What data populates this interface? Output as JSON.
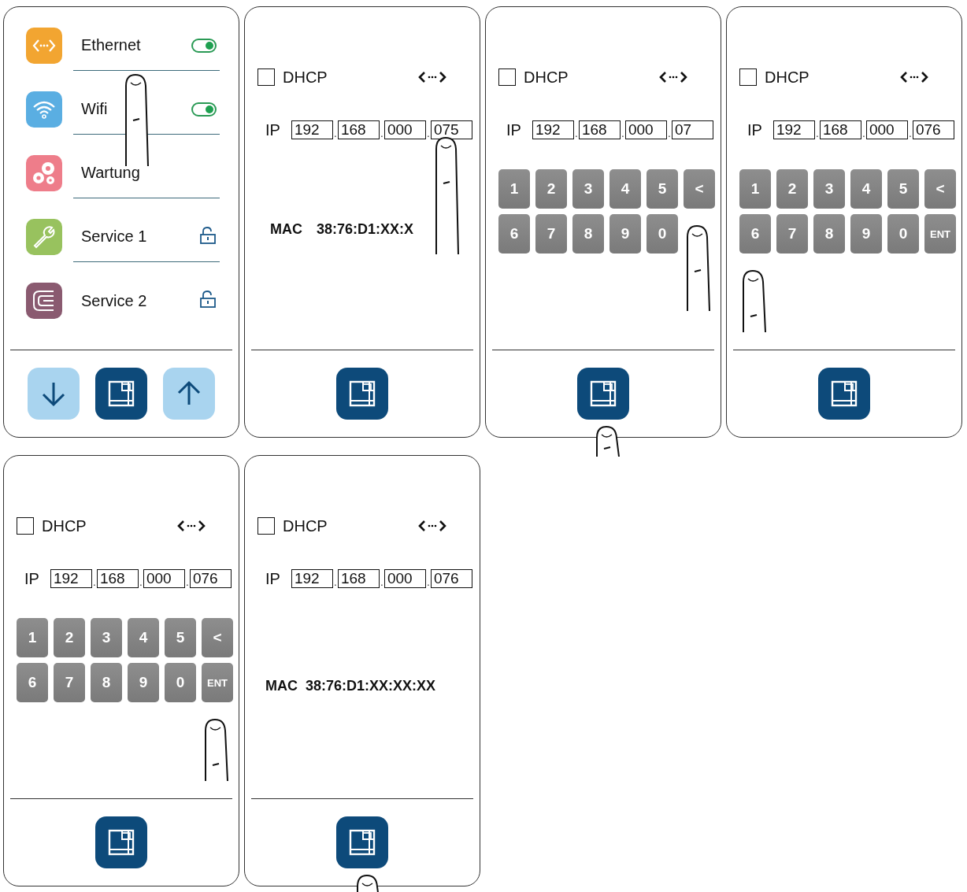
{
  "panels": [
    {
      "kind": "menu",
      "items": [
        {
          "label": "Ethernet",
          "kind": "toggle",
          "on": true,
          "color": "#f2a531"
        },
        {
          "label": "Wifi",
          "kind": "toggle",
          "on": true,
          "color": "#5aaee2"
        },
        {
          "label": "Wartung",
          "kind": "plain",
          "color": "#ee7d8a"
        },
        {
          "label": "Service 1",
          "kind": "lock",
          "color": "#98c25e"
        },
        {
          "label": "Service 2",
          "kind": "lock",
          "color": "#8a5a70"
        }
      ],
      "scroll_buttons": true
    },
    {
      "kind": "network",
      "dhcp": {
        "label": "DHCP",
        "checked": false
      },
      "ip": {
        "label": "IP",
        "separator": ".",
        "octets": [
          "192",
          "168",
          "000",
          "075"
        ]
      },
      "mac": {
        "label": "MAC",
        "value": "38:76:D1:XX:X"
      }
    },
    {
      "kind": "network",
      "dhcp": {
        "label": "DHCP",
        "checked": false
      },
      "ip": {
        "label": "IP",
        "separator": ".",
        "octets": [
          "192",
          "168",
          "000",
          "07"
        ]
      },
      "keys": [
        "1",
        "2",
        "3",
        "4",
        "5",
        "<",
        "6",
        "7",
        "8",
        "9",
        "0"
      ]
    },
    {
      "kind": "network",
      "dhcp": {
        "label": "DHCP",
        "checked": false
      },
      "ip": {
        "label": "IP",
        "separator": ".",
        "octets": [
          "192",
          "168",
          "000",
          "076"
        ]
      },
      "keys": [
        "1",
        "2",
        "3",
        "4",
        "5",
        "<",
        "6",
        "7",
        "8",
        "9",
        "0",
        "ENT"
      ]
    },
    {
      "kind": "network",
      "dhcp": {
        "label": "DHCP",
        "checked": false
      },
      "ip": {
        "label": "IP",
        "separator": ".",
        "octets": [
          "192",
          "168",
          "000",
          "076"
        ]
      },
      "keys": [
        "1",
        "2",
        "3",
        "4",
        "5",
        "<",
        "6",
        "7",
        "8",
        "9",
        "0",
        "ENT"
      ]
    },
    {
      "kind": "network",
      "dhcp": {
        "label": "DHCP",
        "checked": false
      },
      "ip": {
        "label": "IP",
        "separator": ".",
        "octets": [
          "192",
          "168",
          "000",
          "076"
        ]
      },
      "mac": {
        "label": "MAC",
        "value": "38:76:D1:XX:XX:XX"
      }
    }
  ]
}
